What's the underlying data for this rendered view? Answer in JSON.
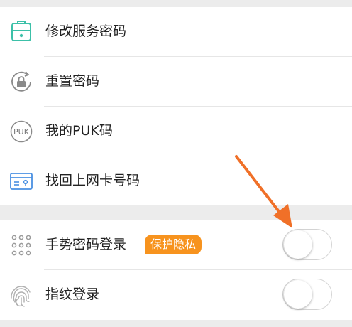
{
  "menu": {
    "items": [
      {
        "label": "修改服务密码",
        "icon": "lock-icon"
      },
      {
        "label": "重置密码",
        "icon": "reset-lock-icon"
      },
      {
        "label": "我的PUK码",
        "icon": "puk-icon",
        "icon_text": "PUK"
      },
      {
        "label": "找回上网卡号码",
        "icon": "card-icon"
      }
    ]
  },
  "security": {
    "gesture": {
      "label": "手势密码登录",
      "badge": "保护隐私",
      "icon": "gesture-grid-icon",
      "enabled": false
    },
    "fingerprint": {
      "label": "指纹登录",
      "icon": "fingerprint-icon",
      "enabled": false
    }
  },
  "colors": {
    "accent_teal": "#3cc0a8",
    "badge_orange": "#f7931e",
    "arrow_orange": "#f07028",
    "card_blue": "#4a90e2"
  }
}
